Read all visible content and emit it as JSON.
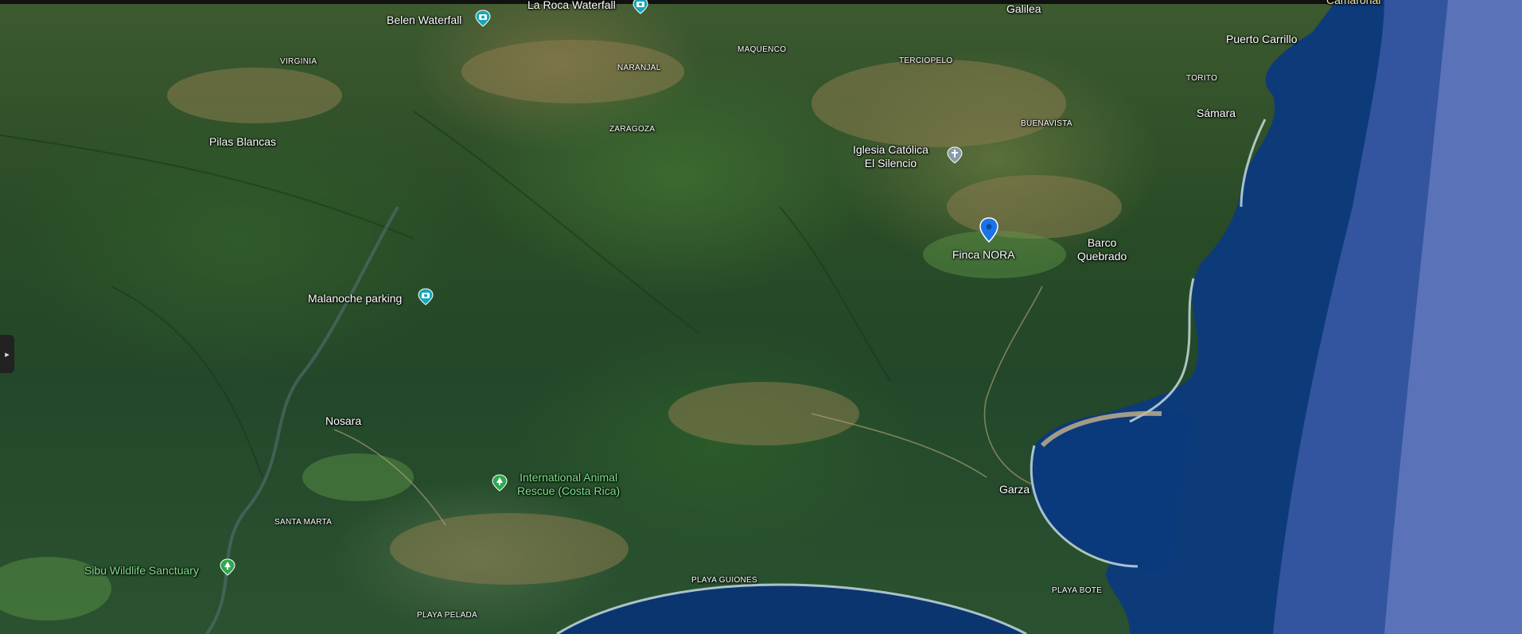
{
  "map": {
    "places": {
      "la_roca": "La Roca Waterfall",
      "belen": "Belen Waterfall",
      "galilea": "Galilea",
      "camaronal": "Camaronal",
      "puerto_carrillo": "Puerto Carrillo",
      "torito": "TORITO",
      "samara": "Sámara",
      "virginia": "VIRGINIA",
      "maquenco": "MAQUENCO",
      "naranjal": "NARANJAL",
      "terciopelo": "TERCIOPELO",
      "zaragoza": "ZARAGOZA",
      "buenavista": "BUENAVISTA",
      "pilas_blancas": "Pilas Blancas",
      "iglesia_line1": "Iglesia Católica",
      "iglesia_line2": "El Silencio",
      "finca": "Finca  NORA",
      "barco_line1": "Barco",
      "barco_line2": "Quebrado",
      "malanoche": "Malanoche parking",
      "nosara": "Nosara",
      "rescue_line1": "International Animal",
      "rescue_line2": "Rescue (Costa Rica)",
      "garza": "Garza",
      "santa_marta": "SANTA MARTA",
      "sibu": "Sibu Wildlife Sanctuary",
      "playa_guiones": "PLAYA GUIONES",
      "playa_bote": "PLAYA BOTE",
      "playa_pelada": "PLAYA PELADA"
    },
    "icons": {
      "photo": "camera-pin-icon",
      "church": "church-pin-icon",
      "park": "tree-pin-icon",
      "marker": "location-marker-icon",
      "sidebar": "chevron-right-icon"
    },
    "colors": {
      "photo_pin": "#18a6b8",
      "church_pin": "#8a9aa8",
      "park_pin": "#2fa84f",
      "marker": "#1a73e8",
      "park_label": "#7ee38a"
    },
    "sidebar_toggle": "▸"
  }
}
